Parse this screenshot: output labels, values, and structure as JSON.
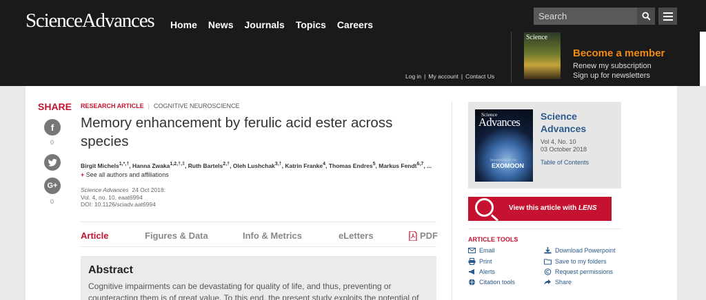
{
  "header": {
    "logo": "ScienceAdvances",
    "nav": [
      "Home",
      "News",
      "Journals",
      "Topics",
      "Careers"
    ],
    "search_placeholder": "Search",
    "util_links": [
      "Log in",
      "My account",
      "Contact Us"
    ],
    "cover_text": "Science",
    "member_title": "Become a member",
    "member_links": [
      "Renew my subscription",
      "Sign up for newsletters"
    ]
  },
  "share": {
    "title": "SHARE",
    "counts": [
      "0",
      "0"
    ]
  },
  "article": {
    "type": "RESEARCH ARTICLE",
    "subject": "COGNITIVE NEUROSCIENCE",
    "title": "Memory enhancement by ferulic acid ester across species",
    "authors": "Birgit Michels1,*,†, Hanna Zwaka1,2,†,‡, Ruth Bartels2,†, Oleh Lushchak3,†, Katrin Franke4, Thomas Endres5, Markus Fendt6,7, ...",
    "see_all": "See all authors and affiliations",
    "journal": "Science Advances",
    "date": "24 Oct 2018:",
    "volume": "Vol. 4, no. 10, eaat6994",
    "doi": "DOI: 10.1126/sciadv.aat6994"
  },
  "tabs": [
    "Article",
    "Figures & Data",
    "Info & Metrics",
    "eLetters",
    "PDF"
  ],
  "abstract": {
    "heading": "Abstract",
    "text": "Cognitive impairments can be devastating for quality of life, and thus, preventing or counteracting them is of great value. To this end, the present study exploits the potential of"
  },
  "sidebar": {
    "cover_small": "Science",
    "cover_big": "Advances",
    "cover_tag": "SHADOWS OF AN",
    "cover_headline": "EXOMOON",
    "journal_name": "Science Advances",
    "issue": "Vol 4, No. 10",
    "issue_date": "03 October 2018",
    "toc": "Table of Contents",
    "lens_label": "View this article with ",
    "lens_brand": "LENS",
    "tools_title": "ARTICLE TOOLS",
    "tools_left": [
      "Email",
      "Print",
      "Alerts",
      "Citation tools"
    ],
    "tools_right": [
      "Download Powerpoint",
      "Save to my folders",
      "Request permissions",
      "Share"
    ]
  },
  "colors": {
    "accent": "#c41230",
    "link": "#2a5a8c",
    "orange": "#f08a12",
    "header_bg": "#1a1a1a"
  }
}
